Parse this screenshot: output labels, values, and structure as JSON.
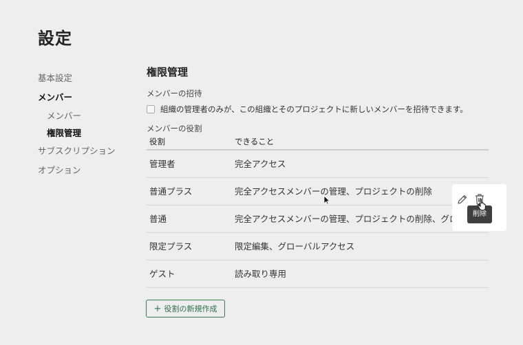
{
  "page": {
    "title": "設定"
  },
  "sidebar": {
    "items": [
      {
        "label": "基本設定"
      },
      {
        "label": "メンバー"
      },
      {
        "label": "メンバー"
      },
      {
        "label": "権限管理"
      },
      {
        "label": "サブスクリプション"
      },
      {
        "label": "オプション"
      }
    ]
  },
  "main": {
    "section_title": "権限管理",
    "invite": {
      "heading": "メンバーの招待",
      "checkbox_label": "組織の管理者のみが、この組織とそのプロジェクトに新しいメンバーを招待できます。",
      "checked": false
    },
    "roles": {
      "heading": "メンバーの役割",
      "columns": [
        "役割",
        "できること"
      ],
      "rows": [
        {
          "role": "管理者",
          "desc": "完全アクセス"
        },
        {
          "role": "普通プラス",
          "desc": "完全アクセスメンバーの管理、プロジェクトの削除"
        },
        {
          "role": "普通",
          "desc": "完全アクセスメンバーの管理、プロジェクトの削除、グローバルアクセス"
        },
        {
          "role": "限定プラス",
          "desc": "限定編集、グローバルアクセス"
        },
        {
          "role": "ゲスト",
          "desc": "読み取り専用"
        }
      ]
    },
    "row_actions": {
      "tooltip": "削除",
      "edit_icon": "pencil-icon",
      "delete_icon": "trash-icon"
    },
    "create_button": {
      "plus": "+",
      "label": "役割の新規作成"
    }
  },
  "colors": {
    "background": "#eeeeee",
    "accent": "#2f6e48",
    "tooltip_bg": "#3f3f3f"
  }
}
